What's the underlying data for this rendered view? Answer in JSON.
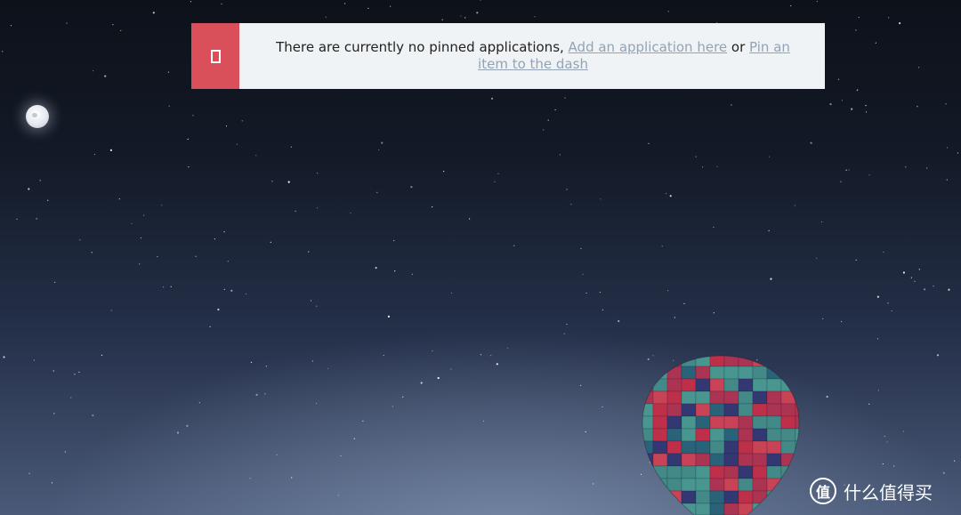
{
  "notice": {
    "message": "There are currently no pinned applications, ",
    "link_add": "Add an application here",
    "connector": " or ",
    "link_pin": "Pin an item to the dash",
    "icon": "phone-outline-icon",
    "accent_color": "#d9505a",
    "background_color": "#eff3f6"
  },
  "background": {
    "moon": "moon-icon",
    "balloon": "hot-air-balloon-image"
  },
  "watermark": {
    "logo_char": "值",
    "text": "什么值得买"
  }
}
